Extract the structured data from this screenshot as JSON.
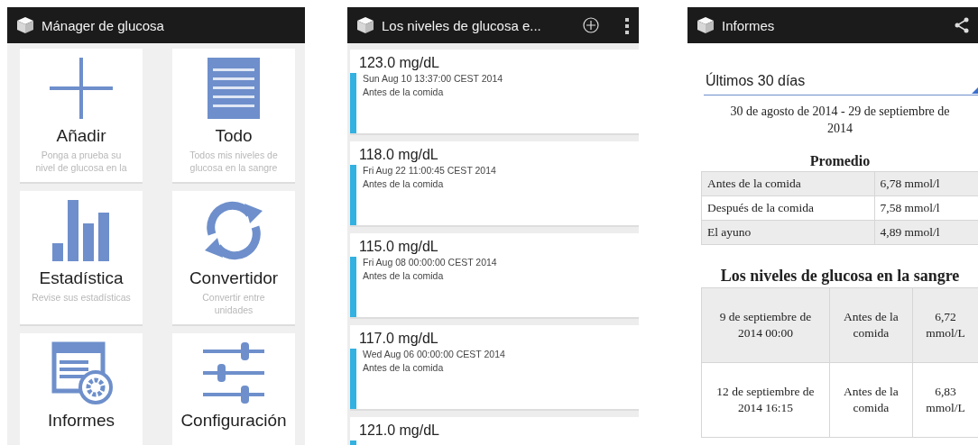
{
  "main_menu": {
    "app_bar": {
      "title": "Mánager de glucosa"
    },
    "tiles": [
      {
        "kind": "plus",
        "title": "Añadir",
        "subtitle": "Ponga a prueba su nivel de glucosa en la"
      },
      {
        "kind": "list",
        "title": "Todo",
        "subtitle": "Todos mis niveles de glucosa en la sangre"
      },
      {
        "kind": "bars",
        "title": "Estadística",
        "subtitle": "Revise sus estadísticas"
      },
      {
        "kind": "sync",
        "title": "Convertidor",
        "subtitle": "Convertir entre unidades"
      },
      {
        "kind": "report",
        "title": "Informes"
      },
      {
        "kind": "sliders",
        "title": "Configuración"
      }
    ]
  },
  "glucose_list": {
    "app_bar": {
      "title": "Los niveles de glucosa e..."
    },
    "entries": [
      {
        "value": "123.0 mg/dL",
        "date": "Sun Aug 10 13:37:00 CEST 2014",
        "note": "Antes de la comida"
      },
      {
        "value": "118.0 mg/dL",
        "date": "Fri Aug 22 11:00:45 CEST 2014",
        "note": "Antes de la comida"
      },
      {
        "value": "115.0 mg/dL",
        "date": "Fri Aug 08 00:00:00 CEST 2014",
        "note": "Antes de la comida"
      },
      {
        "value": "117.0 mg/dL",
        "date": "Wed Aug 06 00:00:00 CEST 2014",
        "note": "Antes de la comida"
      },
      {
        "value": "121.0 mg/dL"
      }
    ]
  },
  "reports": {
    "app_bar": {
      "title": "Informes"
    },
    "period_dropdown": {
      "value": "Últimos 30 días"
    },
    "date_range": "30 de agosto de 2014 - 29 de septiembre de 2014",
    "average": {
      "title": "Promedio",
      "rows": [
        [
          "Antes de la comida",
          "6,78 mmol/l"
        ],
        [
          "Después de la comida",
          "7,58 mmol/l"
        ],
        [
          "El ayuno",
          "4,89 mmol/l"
        ]
      ]
    },
    "levels": {
      "title": "Los niveles de glucosa en la sangre",
      "rows": [
        [
          "9 de septiembre de 2014 00:00",
          "Antes de la comida",
          "6,72 mmol/L"
        ],
        [
          "12 de septiembre de 2014 16:15",
          "Antes de la comida",
          "6,83 mmol/L"
        ]
      ]
    }
  }
}
